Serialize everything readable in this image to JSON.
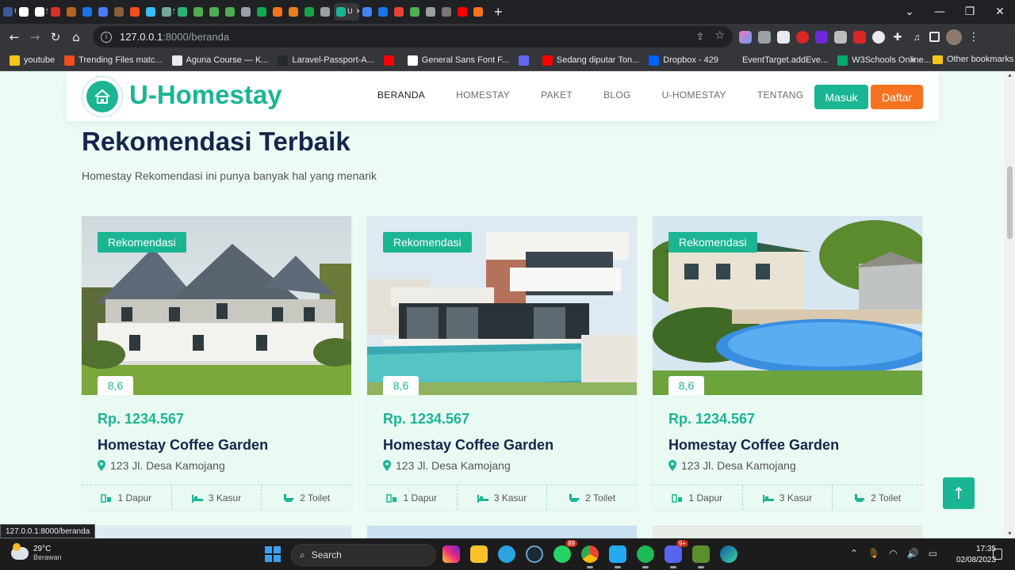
{
  "browser": {
    "tabs": [
      {
        "icon": "uh-tab-icon",
        "label": "UH",
        "color": "#3c5a99"
      },
      {
        "icon": "tab-icon",
        "label": "",
        "color": "#ffffff"
      },
      {
        "icon": "tab-icon",
        "label": "S",
        "color": "#ffffff"
      },
      {
        "icon": "tab-icon",
        "label": "",
        "color": "#d93025"
      },
      {
        "icon": "tab-icon",
        "label": "",
        "color": "#b5651d"
      },
      {
        "icon": "tab-icon",
        "label": "",
        "color": "#1a73e8"
      },
      {
        "icon": "tab-icon",
        "label": "",
        "color": "#4a7bf5"
      },
      {
        "icon": "tab-icon",
        "label": "",
        "color": "#8b5e3c"
      },
      {
        "icon": "tab-icon",
        "label": "",
        "color": "#f24e1e"
      },
      {
        "icon": "tab-icon",
        "label": "",
        "color": "#38bdf8"
      },
      {
        "icon": "tab-icon",
        "label": "S",
        "color": "#74aa9c"
      },
      {
        "icon": "tab-icon",
        "label": "",
        "color": "#2bb673"
      },
      {
        "icon": "tab-icon",
        "label": "",
        "color": "#4caf50"
      },
      {
        "icon": "tab-icon",
        "label": "",
        "color": "#4caf50"
      },
      {
        "icon": "tab-icon",
        "label": "",
        "color": "#4caf50"
      },
      {
        "icon": "tab-icon",
        "label": "",
        "color": "#9aa0a6"
      },
      {
        "icon": "tab-icon",
        "label": "",
        "color": "#0fa958"
      },
      {
        "icon": "tab-icon",
        "label": "",
        "color": "#f97316"
      },
      {
        "icon": "tab-icon",
        "label": "",
        "color": "#e67e22"
      },
      {
        "icon": "tab-icon",
        "label": "",
        "color": "#16a34a"
      },
      {
        "icon": "tab-icon",
        "label": "",
        "color": "#9aa0a6"
      }
    ],
    "tabs_after": [
      {
        "icon": "tab-icon",
        "label": "",
        "color": "#4285f4"
      },
      {
        "icon": "tab-icon",
        "label": "",
        "color": "#1a73e8"
      },
      {
        "icon": "tab-icon",
        "label": "",
        "color": "#ea4335"
      },
      {
        "icon": "tab-icon",
        "label": "",
        "color": "#4caf50"
      },
      {
        "icon": "tab-icon",
        "label": "",
        "color": "#9aa0a6"
      },
      {
        "icon": "tab-icon",
        "label": "",
        "color": "#777777"
      },
      {
        "icon": "tab-icon",
        "label": "",
        "color": "#ff0000"
      },
      {
        "icon": "tab-icon",
        "label": "",
        "color": "#f97316"
      }
    ],
    "active_tab_label": "U",
    "url_host": "127.0.0.1",
    "url_path": ":8000/beranda",
    "bookmarks": [
      {
        "label": "youtube",
        "color": "#f5c518"
      },
      {
        "label": "Trending Files matc...",
        "color": "#f24e1e"
      },
      {
        "label": "Aguna Course — K...",
        "color": "#e8eaed"
      },
      {
        "label": "Laravel-Passport-A...",
        "color": "#24292e"
      },
      {
        "label": "",
        "color": "#ff0000"
      },
      {
        "label": "General Sans Font F...",
        "color": "#ffffff"
      },
      {
        "label": "",
        "color": "#6366f1"
      },
      {
        "label": "Sedang diputar Ton...",
        "color": "#ff0000"
      },
      {
        "label": "Dropbox - 429",
        "color": "#0061ff"
      },
      {
        "label": "EventTarget.addEve...",
        "color": "#35363a"
      },
      {
        "label": "W3Schools Online...",
        "color": "#04aa6d"
      }
    ],
    "bookmarks_more": "»",
    "other_bookmarks": "Other bookmarks",
    "status_url": "127.0.0.1:8000/beranda"
  },
  "site": {
    "brand": "U-Homestay",
    "nav": [
      {
        "label": "BERANDA",
        "active": true
      },
      {
        "label": "HOMESTAY",
        "active": false
      },
      {
        "label": "PAKET",
        "active": false
      },
      {
        "label": "BLOG",
        "active": false
      },
      {
        "label": "U-HOMESTAY",
        "active": false
      },
      {
        "label": "TENTANG",
        "active": false
      }
    ],
    "login": "Masuk",
    "register": "Daftar",
    "colors": {
      "primary": "#1bb593",
      "accent": "#f5731f",
      "heading": "#16254a"
    }
  },
  "section": {
    "title": "Rekomendasi Terbaik",
    "subtitle": "Homestay Rekomendasi ini punya banyak hal yang menarik"
  },
  "cards": [
    {
      "badge": "Rekomendasi",
      "rating": "8,6",
      "price": "Rp. 1234.567",
      "name": "Homestay Coffee Garden",
      "address": "123 Jl. Desa Kamojang",
      "kitchen": "1 Dapur",
      "beds": "3 Kasur",
      "toilets": "2 Toilet"
    },
    {
      "badge": "Rekomendasi",
      "rating": "8,6",
      "price": "Rp. 1234.567",
      "name": "Homestay Coffee Garden",
      "address": "123 Jl. Desa Kamojang",
      "kitchen": "1 Dapur",
      "beds": "3 Kasur",
      "toilets": "2 Toilet"
    },
    {
      "badge": "Rekomendasi",
      "rating": "8,6",
      "price": "Rp. 1234.567",
      "name": "Homestay Coffee Garden",
      "address": "123 Jl. Desa Kamojang",
      "kitchen": "1 Dapur",
      "beds": "3 Kasur",
      "toilets": "2 Toilet"
    }
  ],
  "taskbar": {
    "temp": "29°C",
    "weather": "Berawan",
    "search": "Search",
    "whatsapp_count": "89",
    "discord_count": "9+",
    "time": "17:35",
    "date": "02/08/2023"
  }
}
